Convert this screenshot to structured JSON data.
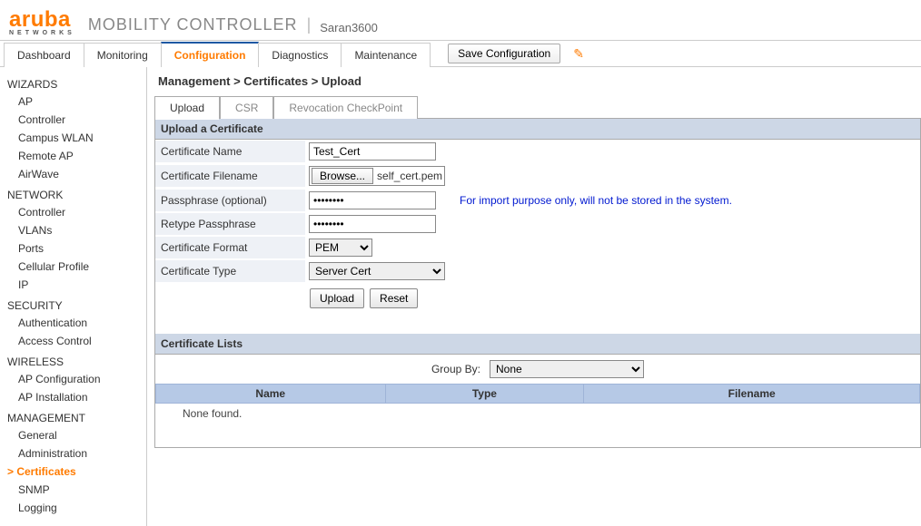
{
  "header": {
    "brand_main": "aruba",
    "brand_sub": "NETWORKS",
    "title": "MOBILITY CONTROLLER",
    "device": "Saran3600"
  },
  "topnav": {
    "tabs": [
      "Dashboard",
      "Monitoring",
      "Configuration",
      "Diagnostics",
      "Maintenance"
    ],
    "active_index": 2,
    "save_button": "Save Configuration"
  },
  "sidebar": {
    "groups": [
      {
        "title": "WIZARDS",
        "items": [
          "AP",
          "Controller",
          "Campus WLAN",
          "Remote AP",
          "AirWave"
        ]
      },
      {
        "title": "NETWORK",
        "items": [
          "Controller",
          "VLANs",
          "Ports",
          "Cellular Profile",
          "IP"
        ]
      },
      {
        "title": "SECURITY",
        "items": [
          "Authentication",
          "Access Control"
        ]
      },
      {
        "title": "WIRELESS",
        "items": [
          "AP Configuration",
          "AP Installation"
        ]
      },
      {
        "title": "MANAGEMENT",
        "items": [
          "General",
          "Administration",
          "Certificates",
          "SNMP",
          "Logging"
        ]
      }
    ],
    "active": "Certificates"
  },
  "breadcrumb": "Management > Certificates > Upload",
  "subtabs": {
    "items": [
      "Upload",
      "CSR",
      "Revocation CheckPoint"
    ],
    "active_index": 0
  },
  "form": {
    "section_title": "Upload a Certificate",
    "labels": {
      "cert_name": "Certificate Name",
      "cert_file": "Certificate Filename",
      "passphrase": "Passphrase (optional)",
      "retype": "Retype Passphrase",
      "format": "Certificate Format",
      "type": "Certificate Type"
    },
    "values": {
      "cert_name": "Test_Cert",
      "browse_button": "Browse...",
      "filename": "self_cert.pem",
      "passphrase": "••••••••",
      "retype": "••••••••",
      "format": "PEM",
      "type": "Server Cert"
    },
    "hint": "For import purpose only, will not be stored in the system.",
    "buttons": {
      "upload": "Upload",
      "reset": "Reset"
    }
  },
  "list": {
    "section_title": "Certificate Lists",
    "groupby_label": "Group By:",
    "groupby_value": "None",
    "columns": [
      "Name",
      "Type",
      "Filename"
    ],
    "empty_text": "None found."
  }
}
